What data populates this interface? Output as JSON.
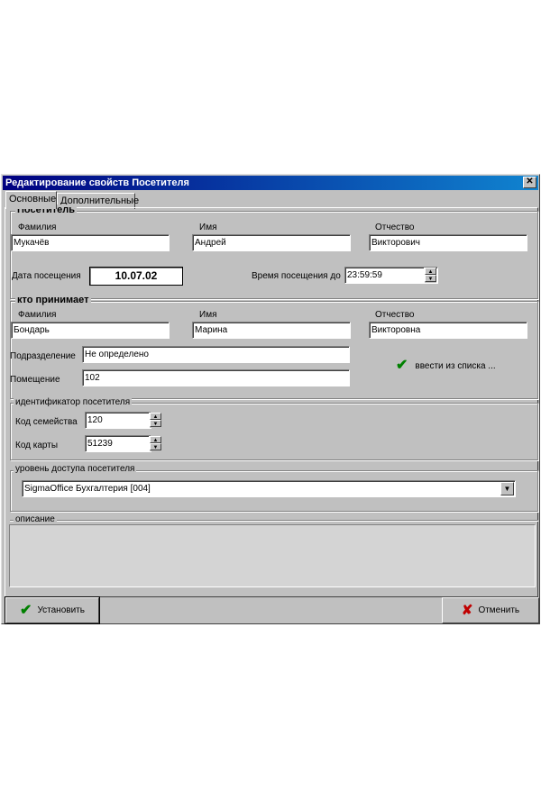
{
  "window": {
    "title": "Редактирование свойств Посетителя",
    "close_glyph": "✕"
  },
  "tabs": [
    {
      "label": "Основные",
      "active": true
    },
    {
      "label": "Дополнительные",
      "active": false
    }
  ],
  "visitor": {
    "section_title": "Посетитель",
    "last_name_label": "Фамилия",
    "first_name_label": "Имя",
    "patronymic_label": "Отчество",
    "last_name": "Мукачёв",
    "first_name": "Андрей",
    "patronymic": "Викторович",
    "visit_date_label": "Дата посещения",
    "visit_date": "10.07.02",
    "visit_time_label": "Время посещения до",
    "visit_time": "23:59:59"
  },
  "host": {
    "section_title": "кто принимает",
    "last_name_label": "Фамилия",
    "first_name_label": "Имя",
    "patronymic_label": "Отчество",
    "last_name": "Бондарь",
    "first_name": "Марина",
    "patronymic": "Викторовна",
    "department_label": "Подразделение",
    "department": "Не определено",
    "room_label": "Помещение",
    "room": "102",
    "pick_from_list_label": "ввести из списка ..."
  },
  "identifier": {
    "section_title": "идентификатор посетителя",
    "family_code_label": "Код семейства",
    "family_code": "120",
    "card_code_label": "Код карты",
    "card_code": "51239"
  },
  "access": {
    "section_title": "уровень доступа посетителя",
    "selected": "SigmaOffice  Бухгалтерия [004]"
  },
  "description": {
    "section_title": "описание",
    "text": ""
  },
  "buttons": {
    "apply": "Установить",
    "cancel": "Отменить"
  },
  "icons": {
    "check": "check-icon",
    "cross": "cross-icon",
    "spin_up": "▲",
    "spin_down": "▼",
    "dropdown": "▼"
  }
}
